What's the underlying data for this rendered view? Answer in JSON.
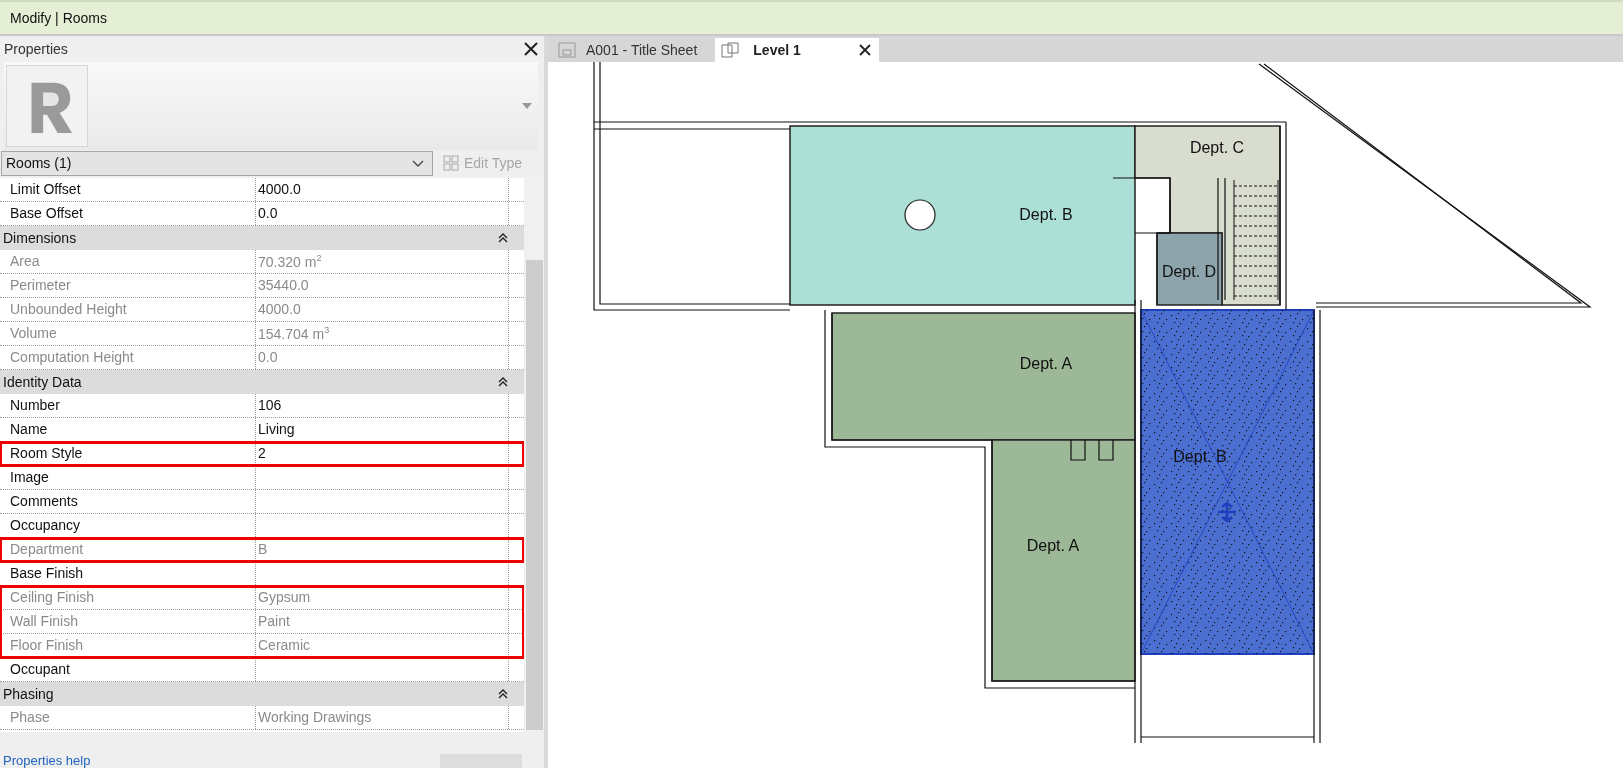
{
  "window": {
    "title": "Modify | Rooms"
  },
  "properties": {
    "title": "Properties",
    "type_selector": "Rooms (1)",
    "edit_type": {
      "label": "Edit Type",
      "disabled": true
    },
    "rows": [
      {
        "kind": "param",
        "label": "Limit Offset",
        "value": "4000.0",
        "readonly": false,
        "highlighted": false
      },
      {
        "kind": "param",
        "label": "Base Offset",
        "value": "0.0",
        "readonly": false,
        "highlighted": false
      },
      {
        "kind": "group",
        "label": "Dimensions",
        "expanded": true
      },
      {
        "kind": "param",
        "label": "Area",
        "value": "70.320 m$^{2}$",
        "readonly": true,
        "highlighted": false
      },
      {
        "kind": "param",
        "label": "Perimeter",
        "value": "35440.0",
        "readonly": true,
        "highlighted": false
      },
      {
        "kind": "param",
        "label": "Unbounded Height",
        "value": "4000.0",
        "readonly": true,
        "highlighted": false
      },
      {
        "kind": "param",
        "label": "Volume",
        "value": "154.704 m$^{3}$",
        "readonly": true,
        "highlighted": false
      },
      {
        "kind": "param",
        "label": "Computation Height",
        "value": "0.0",
        "readonly": true,
        "highlighted": false
      },
      {
        "kind": "group",
        "label": "Identity Data",
        "expanded": true
      },
      {
        "kind": "param",
        "label": "Number",
        "value": "106",
        "readonly": false,
        "highlighted": false
      },
      {
        "kind": "param",
        "label": "Name",
        "value": "Living",
        "readonly": false,
        "highlighted": false
      },
      {
        "kind": "param",
        "label": "Room Style",
        "value": "2",
        "readonly": false,
        "highlighted": true
      },
      {
        "kind": "param",
        "label": "Image",
        "readonly": false,
        "highlighted": false
      },
      {
        "kind": "param",
        "label": "Comments",
        "readonly": false,
        "highlighted": false
      },
      {
        "kind": "param",
        "label": "Occupancy",
        "readonly": false,
        "highlighted": false
      },
      {
        "kind": "param",
        "label": "Department",
        "value": "B",
        "readonly": true,
        "highlighted": true
      },
      {
        "kind": "param",
        "label": "Base Finish",
        "readonly": false,
        "highlighted": false
      },
      {
        "kind": "param",
        "label": "Ceiling Finish",
        "value": "Gypsum",
        "readonly": true,
        "highlighted": true
      },
      {
        "kind": "param",
        "label": "Wall Finish",
        "value": "Paint",
        "readonly": true,
        "highlighted": true
      },
      {
        "kind": "param",
        "label": "Floor Finish",
        "value": "Ceramic",
        "readonly": true,
        "highlighted": true
      },
      {
        "kind": "param",
        "label": "Occupant",
        "readonly": false,
        "highlighted": false
      },
      {
        "kind": "group",
        "label": "Phasing",
        "expanded": true
      },
      {
        "kind": "param",
        "label": "Phase",
        "value": "Working Drawings",
        "readonly": true,
        "highlighted": false
      }
    ],
    "help_link": "Properties help"
  },
  "tabs": [
    {
      "label": "A001 - Title Sheet",
      "kind": "sheet",
      "selected": false
    },
    {
      "label": "Level 1",
      "kind": "plan",
      "selected": true
    }
  ],
  "rooms": [
    {
      "label": "Dept. B",
      "color": "#acdfd6",
      "selected": false
    },
    {
      "label": "Dept. C",
      "color": "#d8ddcf",
      "selected": false
    },
    {
      "label": "Dept. D",
      "color": "#8ea4ad",
      "selected": false
    },
    {
      "label": "Dept. A",
      "color": "#9cb896",
      "selected": false
    },
    {
      "label": "Dept. A",
      "color": "#9cb896",
      "selected": false
    },
    {
      "label": "Dept. B",
      "color": "#4a6fd0",
      "selected": true
    }
  ]
}
